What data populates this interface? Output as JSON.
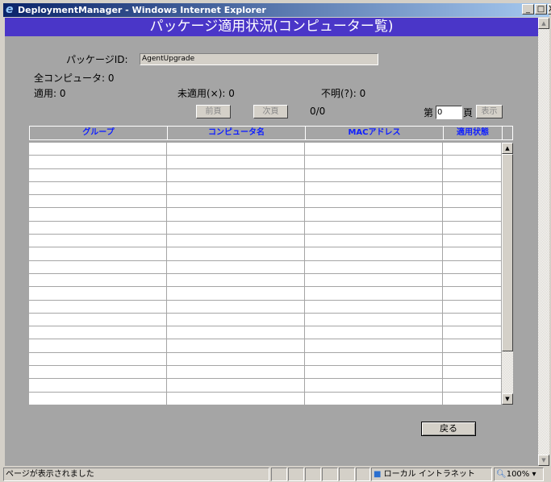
{
  "window": {
    "title": "DeploymentManager - Windows Internet Explorer",
    "minimize": "_",
    "maximize": "□",
    "close": "X"
  },
  "page": {
    "banner": "パッケージ適用状況(コンピューター覧)",
    "package_id_label": "パッケージID:",
    "package_id_value": "AgentUpgrade",
    "all_computers": "全コンピュータ: 0",
    "applied": "適用: 0",
    "not_applied": "未適用(×): 0",
    "unknown": "不明(?): 0",
    "prev_button": "前頁",
    "next_button": "次頁",
    "page_count": "0/0",
    "page_prefix": "第",
    "page_input": "0",
    "page_suffix": "頁",
    "show_button": "表示",
    "columns": [
      "グループ",
      "コンピュータ名",
      "MACアドレス",
      "適用状態"
    ],
    "back_button": "戻る"
  },
  "status": {
    "text": "ページが表示されました",
    "zone": "ローカル イントラネット",
    "zoom": "100%"
  }
}
